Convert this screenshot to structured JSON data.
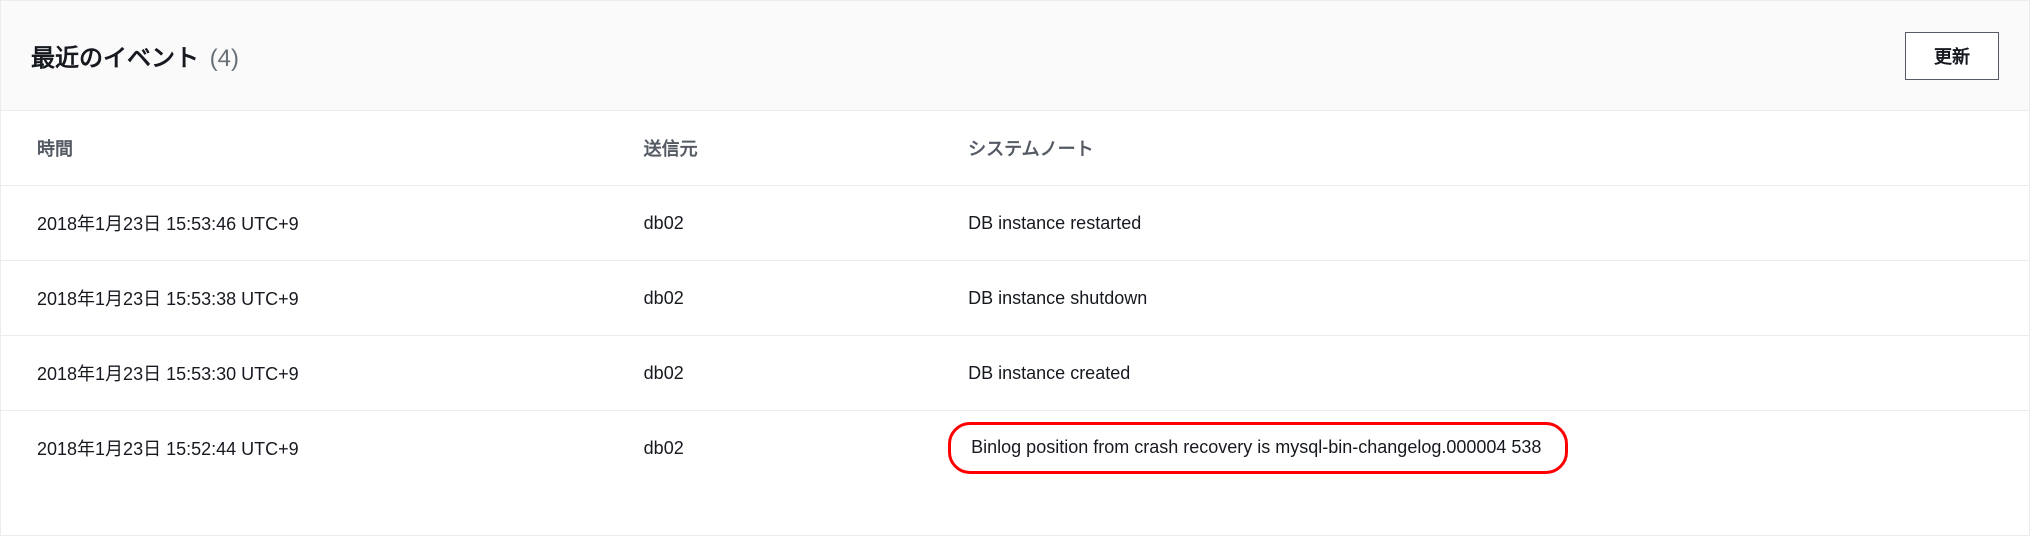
{
  "header": {
    "title": "最近のイベント",
    "count": "(4)",
    "refresh_label": "更新"
  },
  "columns": {
    "time": "時間",
    "source": "送信元",
    "note": "システムノート"
  },
  "rows": [
    {
      "time": "2018年1月23日 15:53:46 UTC+9",
      "source": "db02",
      "note": "DB instance restarted",
      "highlight": false
    },
    {
      "time": "2018年1月23日 15:53:38 UTC+9",
      "source": "db02",
      "note": "DB instance shutdown",
      "highlight": false
    },
    {
      "time": "2018年1月23日 15:53:30 UTC+9",
      "source": "db02",
      "note": "DB instance created",
      "highlight": false
    },
    {
      "time": "2018年1月23日 15:52:44 UTC+9",
      "source": "db02",
      "note": "Binlog position from crash recovery is mysql-bin-changelog.000004 538",
      "highlight": true
    }
  ]
}
